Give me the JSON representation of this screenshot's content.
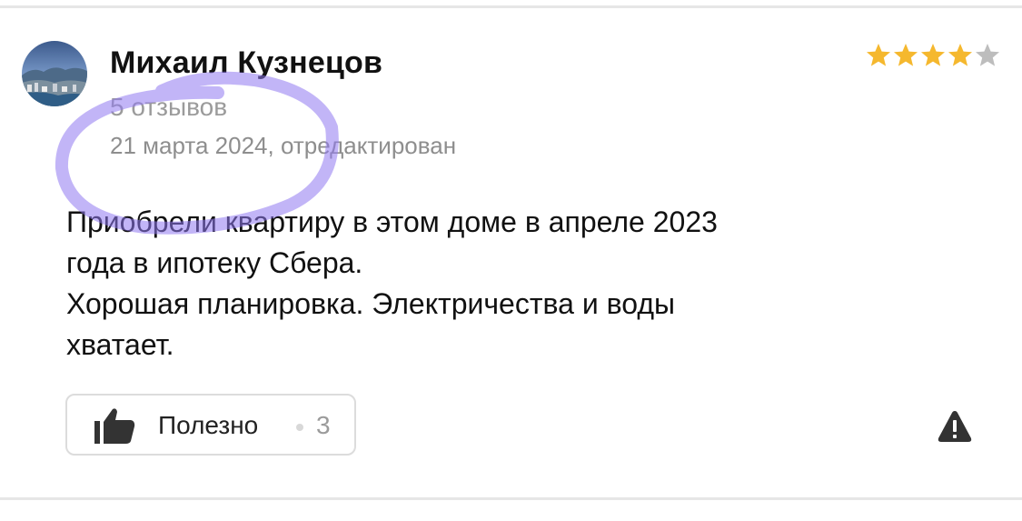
{
  "review": {
    "author_name": "Михаил Кузнецов",
    "review_count": "5 отзывов",
    "date": "21 марта 2024, отредактирован",
    "rating": 4,
    "rating_max": 5,
    "text_lines": [
      "Приобрели квартиру в этом доме в апреле 2023",
      "года в ипотеку Сбера.",
      "Хорошая планировка. Электричества и воды",
      "хватает."
    ]
  },
  "actions": {
    "helpful_label": "Полезно",
    "helpful_count": "3",
    "report_icon": "warning-triangle-icon",
    "like_icon": "thumbs-up-icon"
  },
  "colors": {
    "star_filled": "#f5b82e",
    "star_empty": "#bdbdbd",
    "annotation": "#8f78f0"
  }
}
